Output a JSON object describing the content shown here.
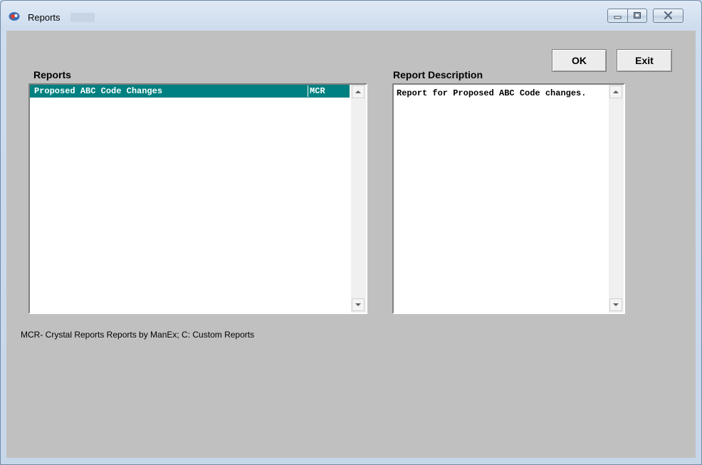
{
  "window": {
    "title": "Reports",
    "controls": {
      "minimize": "minimize-icon",
      "maximize": "maximize-icon",
      "close": "close-icon"
    }
  },
  "toolbar": {
    "ok_label": "OK",
    "exit_label": "Exit"
  },
  "reports": {
    "label": "Reports",
    "items": [
      {
        "name": "Proposed ABC Code Changes",
        "code": "MCR",
        "selected": true
      }
    ]
  },
  "description": {
    "label": "Report Description",
    "text": "Report for Proposed ABC Code changes."
  },
  "footnote": "MCR- Crystal Reports Reports by ManEx;  C: Custom Reports",
  "colors": {
    "selection": "#008080",
    "client_background": "#c0c0c0"
  }
}
